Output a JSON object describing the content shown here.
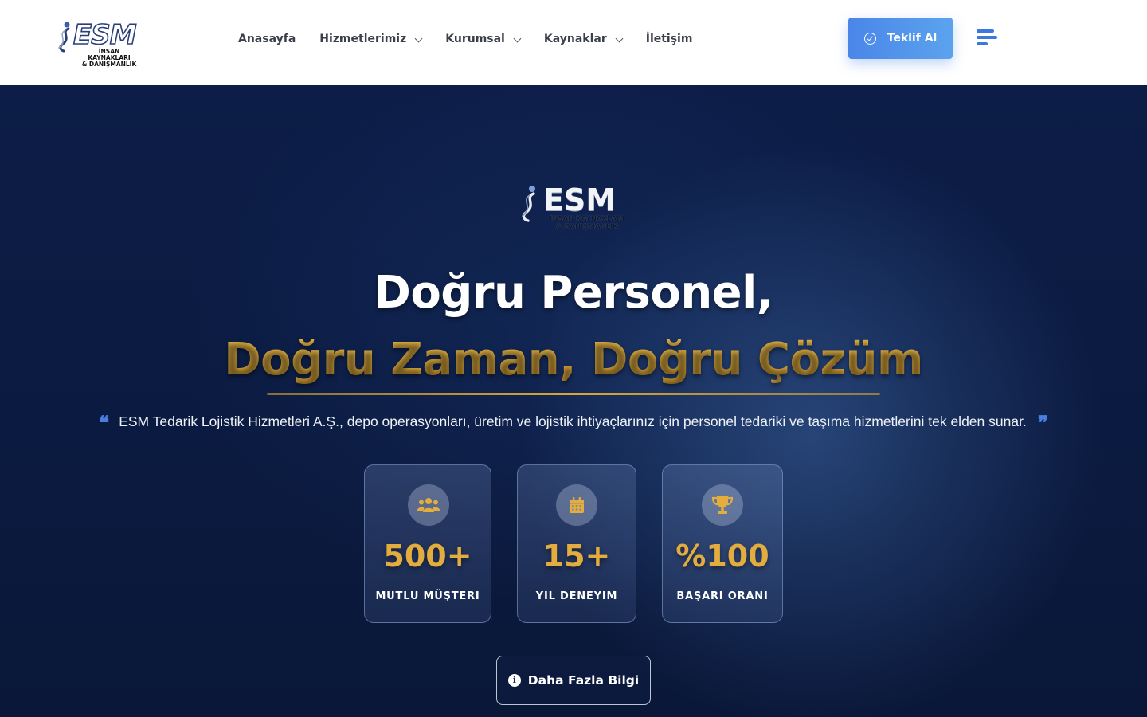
{
  "header": {
    "logo": {
      "text": "ESM",
      "subtitle_line1": "İNSAN KAYNAKLARI",
      "subtitle_line2": "& DANIŞMANLIK"
    },
    "nav": [
      {
        "label": "Anasayfa",
        "has_dropdown": false
      },
      {
        "label": "Hizmetlerimiz",
        "has_dropdown": true
      },
      {
        "label": "Kurumsal",
        "has_dropdown": true
      },
      {
        "label": "Kaynaklar",
        "has_dropdown": true
      },
      {
        "label": "İletişim",
        "has_dropdown": false
      }
    ],
    "cta_label": "Teklif Al",
    "cta_icon": "check-circle-icon",
    "menu_icon": "hamburger-menu-icon"
  },
  "hero": {
    "logo": {
      "text": "ESM",
      "subtitle_line1": "İNSAN KAYNAKLARI",
      "subtitle_line2": "& DANIŞMANLIK"
    },
    "title_line1": "Doğru Personel,",
    "title_line2": "Doğru Zaman, Doğru Çözüm",
    "tagline": "ESM Tedarik Lojistik Hizmetleri A.Ş., depo operasyonları, üretim ve lojistik ihtiyaçlarınız için personel tedariki ve taşıma hizmetlerini tek elden sunar.",
    "quote_open": "❝",
    "quote_close": "❞",
    "stats": [
      {
        "icon": "users-icon",
        "value": "500+",
        "label": "MUTLU MÜŞTERI"
      },
      {
        "icon": "calendar-icon",
        "value": "15+",
        "label": "YIL DENEYIM"
      },
      {
        "icon": "trophy-icon",
        "value": "%100",
        "label": "BAŞARI ORANI"
      }
    ],
    "more_button": {
      "label": "Daha Fazla Bilgi",
      "icon": "info-icon",
      "icon_glyph": "i"
    }
  },
  "colors": {
    "accent_blue": "#4a86e8",
    "gold": "#d7a437",
    "hero_bg": "#0b1a3f"
  }
}
